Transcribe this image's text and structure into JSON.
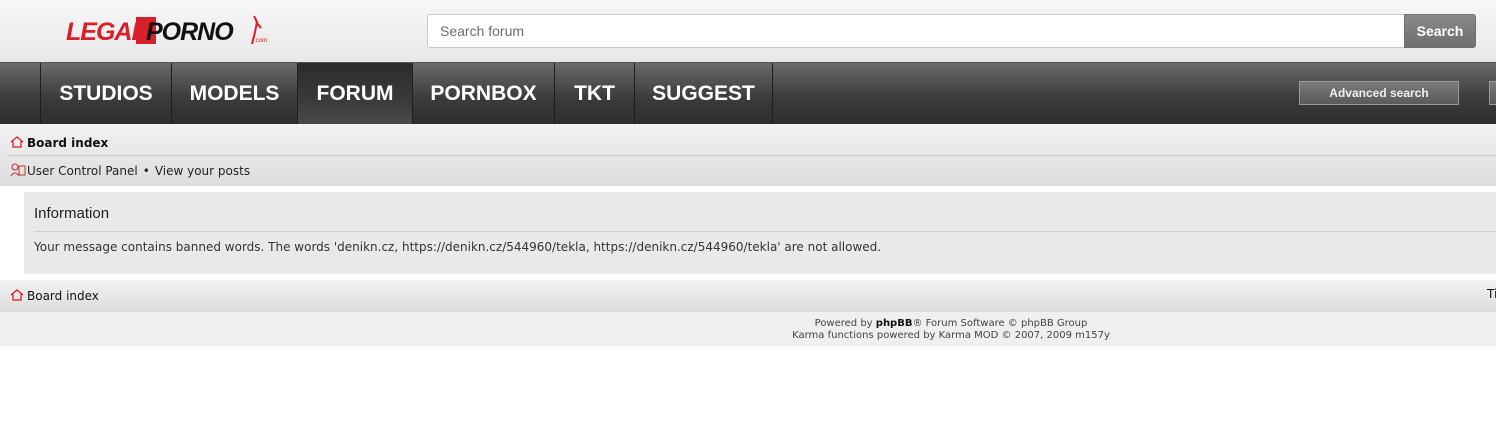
{
  "header": {
    "logo_text": "LEGALPORNO.com",
    "search": {
      "placeholder": "Search forum",
      "value": "",
      "button_label": "Search"
    }
  },
  "nav": {
    "items": [
      {
        "label": "STUDIOS",
        "active": false
      },
      {
        "label": "MODELS",
        "active": false
      },
      {
        "label": "FORUM",
        "active": true
      },
      {
        "label": "PORNBOX",
        "active": false
      },
      {
        "label": "TKT",
        "active": false
      },
      {
        "label": "SUGGEST",
        "active": false
      }
    ],
    "advanced_search_label": "Advanced search"
  },
  "breadcrumb": {
    "board_index": "Board index",
    "user_control_panel": "User Control Panel",
    "separator": "•",
    "view_posts": "View your posts"
  },
  "info": {
    "title": "Information",
    "message": "Your message contains banned words. The words 'denikn.cz, https://denikn.cz/544960/tekla, https://denikn.cz/544960/tekla' are not allowed."
  },
  "bottom": {
    "board_index": "Board index",
    "edge_text": "Ti"
  },
  "footer": {
    "powered_prefix": "Powered by ",
    "phpbb": "phpBB",
    "powered_suffix": "® Forum Software © phpBB Group",
    "karma": "Karma functions powered by Karma MOD © 2007, 2009 m157y"
  },
  "colors": {
    "accent_red": "#d8202a",
    "nav_dark": "#3c3c3c",
    "search_button": "#7a7a7a"
  }
}
